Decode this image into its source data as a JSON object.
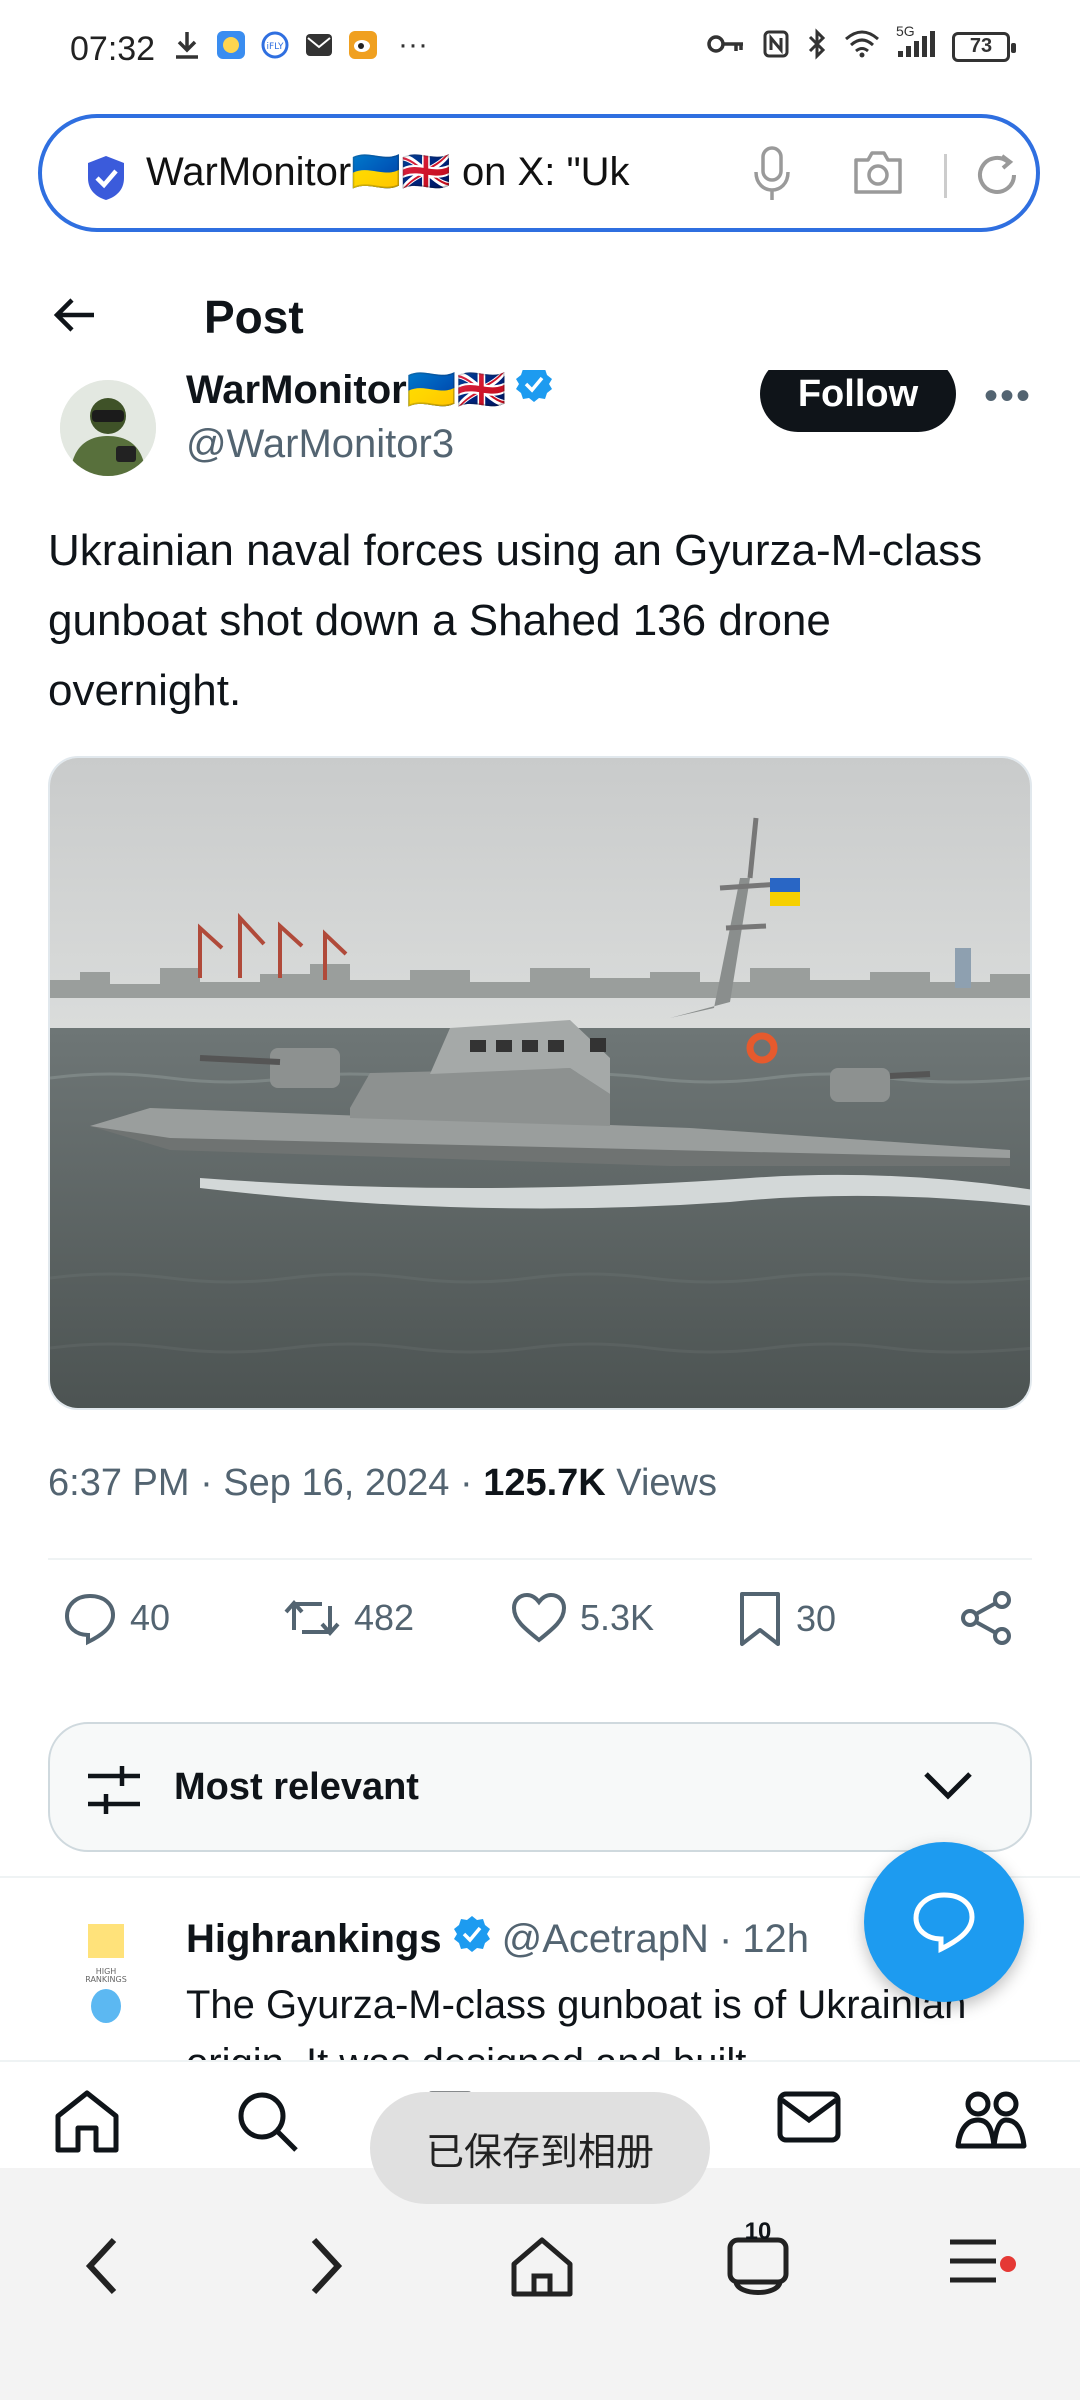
{
  "status_bar": {
    "time": "07:32",
    "network": "5G",
    "battery": "73"
  },
  "browser": {
    "url_text": "WarMonitor🇺🇦🇬🇧 on X: \"Uk",
    "tab_count": "10"
  },
  "header": {
    "title": "Post"
  },
  "author": {
    "name": "WarMonitor🇺🇦🇬🇧",
    "handle": "@WarMonitor3",
    "follow_label": "Follow"
  },
  "tweet": {
    "text": "Ukrainian naval forces using an Gyurza-M-class gunboat shot down a Shahed 136 drone overnight.",
    "time": "6:37 PM",
    "date": "Sep 16, 2024",
    "views_count": "125.7K",
    "views_label": "Views"
  },
  "actions": {
    "replies": "40",
    "reposts": "482",
    "likes": "5.3K",
    "bookmarks": "30"
  },
  "sort": {
    "label": "Most relevant"
  },
  "reply": {
    "name": "Highrankings",
    "handle": "@AcetrapN",
    "time": "12h",
    "text": "The Gyurza-M-class gunboat is of Ukrainian origin. It was designed and built"
  },
  "toast": {
    "text": "已保存到相册"
  },
  "colors": {
    "accent": "#1d9bf0",
    "url_border": "#2f6fe0",
    "text": "#0f1419",
    "muted": "#536471"
  }
}
